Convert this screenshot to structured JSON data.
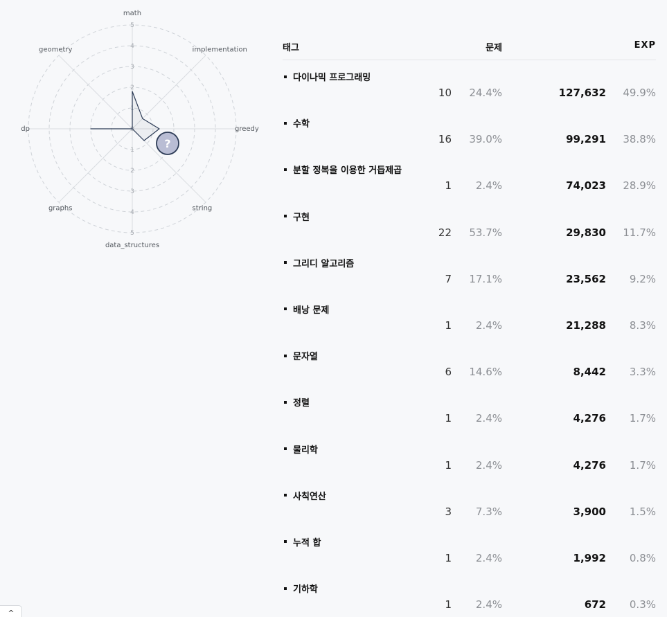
{
  "chart_data": {
    "type": "radar",
    "axes": [
      "math",
      "implementation",
      "greedy",
      "string",
      "data_structures",
      "graphs",
      "dp",
      "geometry"
    ],
    "values": [
      1.8,
      0.7,
      1.3,
      0.8,
      0,
      0,
      2,
      0
    ],
    "scale_max": 5,
    "tick_labels": [
      "0",
      "1",
      "2",
      "3",
      "4",
      "5"
    ],
    "line_color": "#2b3a55",
    "grid_color": "#cfd3d8",
    "marker": "?"
  },
  "table": {
    "headers": {
      "tag": "태그",
      "problems": "문제",
      "exp": "EXP"
    },
    "rows": [
      {
        "tag": "다이나믹 프로그래밍",
        "count": "10",
        "count_pct": "24.4%",
        "exp": "127,632",
        "exp_pct": "49.9%"
      },
      {
        "tag": "수학",
        "count": "16",
        "count_pct": "39.0%",
        "exp": "99,291",
        "exp_pct": "38.8%"
      },
      {
        "tag": "분할 정복을 이용한 거듭제곱",
        "count": "1",
        "count_pct": "2.4%",
        "exp": "74,023",
        "exp_pct": "28.9%"
      },
      {
        "tag": "구현",
        "count": "22",
        "count_pct": "53.7%",
        "exp": "29,830",
        "exp_pct": "11.7%"
      },
      {
        "tag": "그리디 알고리즘",
        "count": "7",
        "count_pct": "17.1%",
        "exp": "23,562",
        "exp_pct": "9.2%"
      },
      {
        "tag": "배낭 문제",
        "count": "1",
        "count_pct": "2.4%",
        "exp": "21,288",
        "exp_pct": "8.3%"
      },
      {
        "tag": "문자열",
        "count": "6",
        "count_pct": "14.6%",
        "exp": "8,442",
        "exp_pct": "3.3%"
      },
      {
        "tag": "정렬",
        "count": "1",
        "count_pct": "2.4%",
        "exp": "4,276",
        "exp_pct": "1.7%"
      },
      {
        "tag": "물리학",
        "count": "1",
        "count_pct": "2.4%",
        "exp": "4,276",
        "exp_pct": "1.7%"
      },
      {
        "tag": "사칙연산",
        "count": "3",
        "count_pct": "7.3%",
        "exp": "3,900",
        "exp_pct": "1.5%"
      },
      {
        "tag": "누적 합",
        "count": "1",
        "count_pct": "2.4%",
        "exp": "1,992",
        "exp_pct": "0.8%"
      },
      {
        "tag": "기하학",
        "count": "1",
        "count_pct": "2.4%",
        "exp": "672",
        "exp_pct": "0.3%"
      }
    ]
  },
  "scroll_top": {
    "icon": "chevron-up-icon",
    "glyph": "^"
  }
}
